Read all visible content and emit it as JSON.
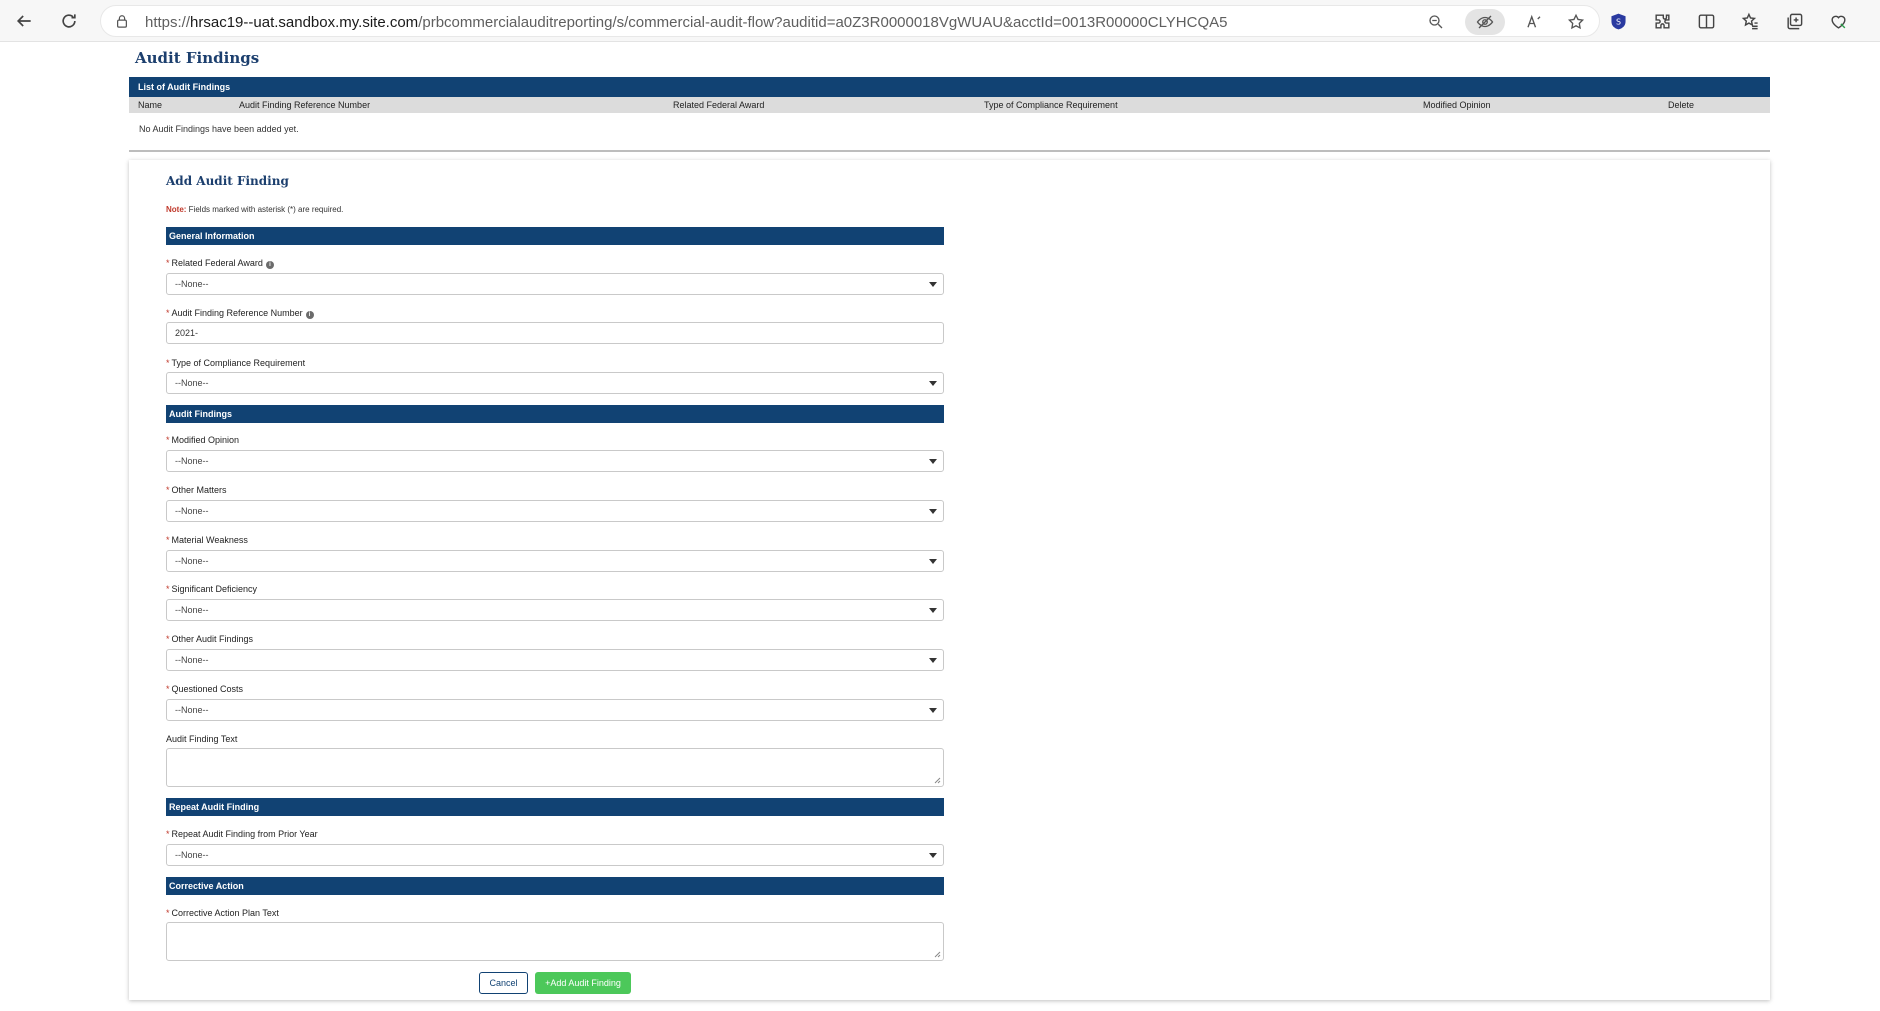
{
  "browser": {
    "url_prefix": "https://",
    "url_host": "hrsac19--uat.sandbox.my.site.com",
    "url_path": "/prbcommercialauditreporting/s/commercial-audit-flow?auditid=a0Z3R0000018VgWUAU&acctId=0013R00000CLYHCQA5",
    "icons": [
      "back-icon",
      "refresh-icon",
      "lock-icon",
      "zoom-out-icon",
      "tracking-prevention-icon",
      "read-aloud-icon",
      "favorite-star-icon",
      "shield-extension-icon",
      "extensions-icon",
      "split-screen-icon",
      "favorites-icon",
      "collections-icon",
      "browser-essentials-icon"
    ]
  },
  "page": {
    "title": "Audit Findings"
  },
  "list": {
    "header": "List of Audit Findings",
    "columns": [
      "Name",
      "Audit Finding Reference Number",
      "Related Federal Award",
      "Type of Compliance Requirement",
      "Modified Opinion",
      "Delete"
    ],
    "empty_message": "No Audit Findings have been added yet."
  },
  "form": {
    "title": "Add Audit Finding",
    "note_label": "Note:",
    "note_text": " Fields marked with asterisk (*) are required.",
    "required_mark": "*",
    "sections": {
      "general": "General Information",
      "findings": "Audit Findings",
      "repeat": "Repeat Audit Finding",
      "corrective": "Corrective Action"
    },
    "fields": {
      "related_federal_award": {
        "label": "Related Federal Award",
        "value": "--None--"
      },
      "reference_number": {
        "label": "Audit Finding Reference Number",
        "value": "2021-"
      },
      "compliance_type": {
        "label": "Type of Compliance Requirement",
        "value": "--None--"
      },
      "modified_opinion": {
        "label": "Modified Opinion",
        "value": "--None--"
      },
      "other_matters": {
        "label": "Other Matters",
        "value": "--None--"
      },
      "material_weakness": {
        "label": "Material Weakness",
        "value": "--None--"
      },
      "significant_deficiency": {
        "label": "Significant Deficiency",
        "value": "--None--"
      },
      "other_audit_findings": {
        "label": "Other Audit Findings",
        "value": "--None--"
      },
      "questioned_costs": {
        "label": "Questioned Costs",
        "value": "--None--"
      },
      "finding_text": {
        "label": "Audit Finding Text",
        "value": ""
      },
      "repeat_prior_year": {
        "label": "Repeat Audit Finding from Prior Year",
        "value": "--None--"
      },
      "corrective_plan": {
        "label": "Corrective Action Plan Text",
        "value": ""
      }
    },
    "buttons": {
      "cancel": "Cancel",
      "add": "+Add Audit Finding"
    }
  },
  "colors": {
    "header_blue": "#114273",
    "title_blue": "#1c3f6e",
    "add_green": "#4cc85a",
    "required_red": "#c0392b"
  }
}
